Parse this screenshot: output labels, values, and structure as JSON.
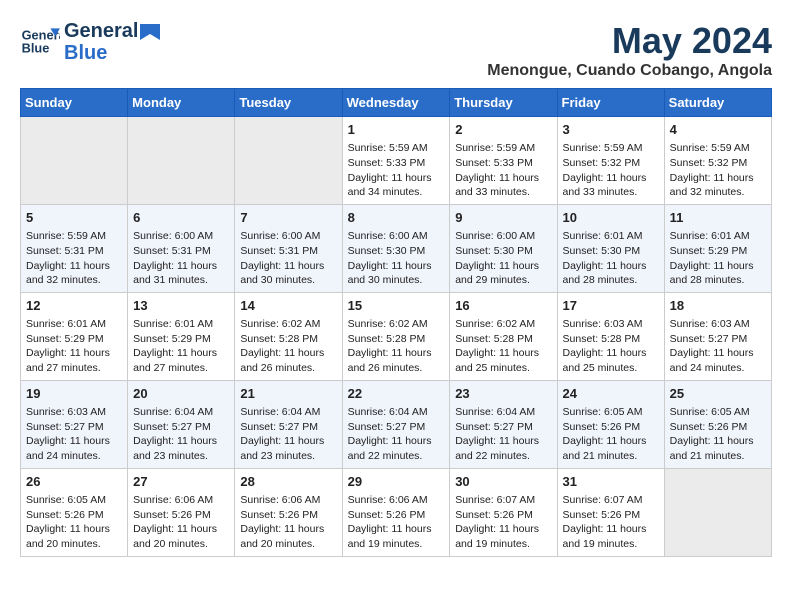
{
  "header": {
    "logo_line1": "General",
    "logo_line2": "Blue",
    "month": "May 2024",
    "location": "Menongue, Cuando Cobango, Angola"
  },
  "weekdays": [
    "Sunday",
    "Monday",
    "Tuesday",
    "Wednesday",
    "Thursday",
    "Friday",
    "Saturday"
  ],
  "weeks": [
    [
      {
        "day": "",
        "info": ""
      },
      {
        "day": "",
        "info": ""
      },
      {
        "day": "",
        "info": ""
      },
      {
        "day": "1",
        "info": "Sunrise: 5:59 AM\nSunset: 5:33 PM\nDaylight: 11 hours\nand 34 minutes."
      },
      {
        "day": "2",
        "info": "Sunrise: 5:59 AM\nSunset: 5:33 PM\nDaylight: 11 hours\nand 33 minutes."
      },
      {
        "day": "3",
        "info": "Sunrise: 5:59 AM\nSunset: 5:32 PM\nDaylight: 11 hours\nand 33 minutes."
      },
      {
        "day": "4",
        "info": "Sunrise: 5:59 AM\nSunset: 5:32 PM\nDaylight: 11 hours\nand 32 minutes."
      }
    ],
    [
      {
        "day": "5",
        "info": "Sunrise: 5:59 AM\nSunset: 5:31 PM\nDaylight: 11 hours\nand 32 minutes."
      },
      {
        "day": "6",
        "info": "Sunrise: 6:00 AM\nSunset: 5:31 PM\nDaylight: 11 hours\nand 31 minutes."
      },
      {
        "day": "7",
        "info": "Sunrise: 6:00 AM\nSunset: 5:31 PM\nDaylight: 11 hours\nand 30 minutes."
      },
      {
        "day": "8",
        "info": "Sunrise: 6:00 AM\nSunset: 5:30 PM\nDaylight: 11 hours\nand 30 minutes."
      },
      {
        "day": "9",
        "info": "Sunrise: 6:00 AM\nSunset: 5:30 PM\nDaylight: 11 hours\nand 29 minutes."
      },
      {
        "day": "10",
        "info": "Sunrise: 6:01 AM\nSunset: 5:30 PM\nDaylight: 11 hours\nand 28 minutes."
      },
      {
        "day": "11",
        "info": "Sunrise: 6:01 AM\nSunset: 5:29 PM\nDaylight: 11 hours\nand 28 minutes."
      }
    ],
    [
      {
        "day": "12",
        "info": "Sunrise: 6:01 AM\nSunset: 5:29 PM\nDaylight: 11 hours\nand 27 minutes."
      },
      {
        "day": "13",
        "info": "Sunrise: 6:01 AM\nSunset: 5:29 PM\nDaylight: 11 hours\nand 27 minutes."
      },
      {
        "day": "14",
        "info": "Sunrise: 6:02 AM\nSunset: 5:28 PM\nDaylight: 11 hours\nand 26 minutes."
      },
      {
        "day": "15",
        "info": "Sunrise: 6:02 AM\nSunset: 5:28 PM\nDaylight: 11 hours\nand 26 minutes."
      },
      {
        "day": "16",
        "info": "Sunrise: 6:02 AM\nSunset: 5:28 PM\nDaylight: 11 hours\nand 25 minutes."
      },
      {
        "day": "17",
        "info": "Sunrise: 6:03 AM\nSunset: 5:28 PM\nDaylight: 11 hours\nand 25 minutes."
      },
      {
        "day": "18",
        "info": "Sunrise: 6:03 AM\nSunset: 5:27 PM\nDaylight: 11 hours\nand 24 minutes."
      }
    ],
    [
      {
        "day": "19",
        "info": "Sunrise: 6:03 AM\nSunset: 5:27 PM\nDaylight: 11 hours\nand 24 minutes."
      },
      {
        "day": "20",
        "info": "Sunrise: 6:04 AM\nSunset: 5:27 PM\nDaylight: 11 hours\nand 23 minutes."
      },
      {
        "day": "21",
        "info": "Sunrise: 6:04 AM\nSunset: 5:27 PM\nDaylight: 11 hours\nand 23 minutes."
      },
      {
        "day": "22",
        "info": "Sunrise: 6:04 AM\nSunset: 5:27 PM\nDaylight: 11 hours\nand 22 minutes."
      },
      {
        "day": "23",
        "info": "Sunrise: 6:04 AM\nSunset: 5:27 PM\nDaylight: 11 hours\nand 22 minutes."
      },
      {
        "day": "24",
        "info": "Sunrise: 6:05 AM\nSunset: 5:26 PM\nDaylight: 11 hours\nand 21 minutes."
      },
      {
        "day": "25",
        "info": "Sunrise: 6:05 AM\nSunset: 5:26 PM\nDaylight: 11 hours\nand 21 minutes."
      }
    ],
    [
      {
        "day": "26",
        "info": "Sunrise: 6:05 AM\nSunset: 5:26 PM\nDaylight: 11 hours\nand 20 minutes."
      },
      {
        "day": "27",
        "info": "Sunrise: 6:06 AM\nSunset: 5:26 PM\nDaylight: 11 hours\nand 20 minutes."
      },
      {
        "day": "28",
        "info": "Sunrise: 6:06 AM\nSunset: 5:26 PM\nDaylight: 11 hours\nand 20 minutes."
      },
      {
        "day": "29",
        "info": "Sunrise: 6:06 AM\nSunset: 5:26 PM\nDaylight: 11 hours\nand 19 minutes."
      },
      {
        "day": "30",
        "info": "Sunrise: 6:07 AM\nSunset: 5:26 PM\nDaylight: 11 hours\nand 19 minutes."
      },
      {
        "day": "31",
        "info": "Sunrise: 6:07 AM\nSunset: 5:26 PM\nDaylight: 11 hours\nand 19 minutes."
      },
      {
        "day": "",
        "info": ""
      }
    ]
  ]
}
